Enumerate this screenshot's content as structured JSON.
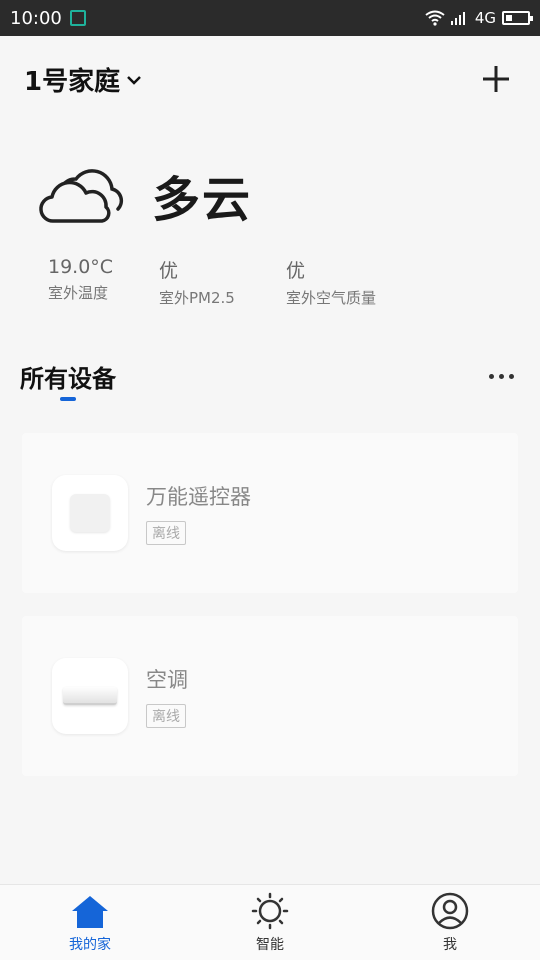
{
  "status_bar": {
    "time": "10:00",
    "network": "4G"
  },
  "header": {
    "home_name": "1号家庭"
  },
  "weather": {
    "condition": "多云"
  },
  "stats": [
    {
      "value": "19.0°C",
      "label": "室外温度"
    },
    {
      "value": "优",
      "label": "室外PM2.5"
    },
    {
      "value": "优",
      "label": "室外空气质量"
    }
  ],
  "section": {
    "title": "所有设备"
  },
  "devices": [
    {
      "name": "万能遥控器",
      "status": "离线"
    },
    {
      "name": "空调",
      "status": "离线"
    }
  ],
  "tabs": [
    {
      "label": "我的家"
    },
    {
      "label": "智能"
    },
    {
      "label": "我"
    }
  ],
  "colors": {
    "accent": "#1565d8",
    "status_bar": "#2b2b2b"
  }
}
